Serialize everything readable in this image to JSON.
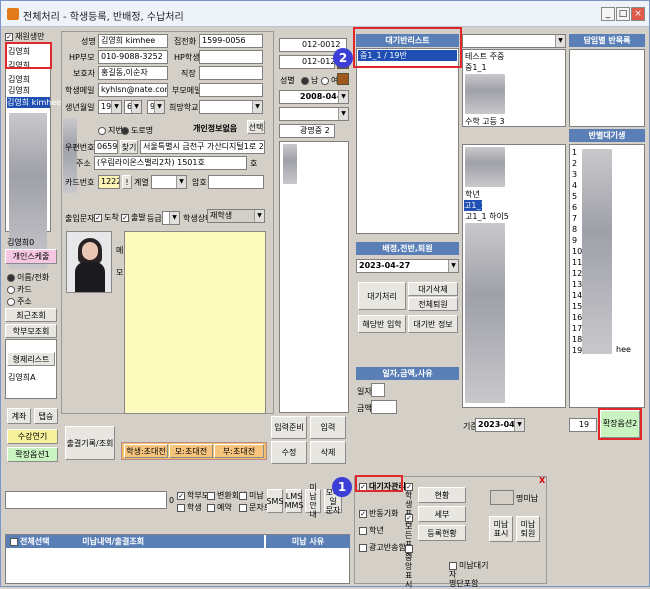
{
  "window": {
    "title": "전체처리 - 학생등록, 반배정, 수납처리"
  },
  "left": {
    "checkall": "재원생만",
    "names": [
      "김영희",
      "김영희",
      "김영희",
      "김영희",
      "김영희 kimhee"
    ],
    "bottom_name": "김영희0",
    "btn_personal": "개인스케줄",
    "radio_name": "이름/전화",
    "radio_card": "카드",
    "radio_addr": "주소",
    "btn_recent": "최근조회",
    "btn_parent": "학부모조회",
    "btn_sibling": "형제리스트",
    "sibling_name": "김영희A",
    "btn_account": "계좌",
    "btn_tab": "탭승",
    "btn_classes": "수강연기",
    "btn_expand1": "확장옵션1"
  },
  "form": {
    "name_label": "성명",
    "name": "김영희 kimhee",
    "home_label": "집전화",
    "home": "1599-0056",
    "hp_label": "HP부모",
    "hp": "010-9088-3252",
    "hp2_label": "HP학생",
    "hp2": "",
    "guardian_label": "보호자",
    "guardian": "홍길동,이순자",
    "job_label": "직장",
    "job": "",
    "email_label": "학생메일",
    "email": "kyhlsn@nate.com",
    "pmail_label": "부모메일",
    "pmail": "",
    "birth_label": "생년월일",
    "birth_y": "1987",
    "birth_m": "6",
    "birth_d": "9",
    "hope_label": "희망학교",
    "hope": "",
    "addr_type_old": "지번",
    "addr_type_new": "도로명",
    "noinfo": "개인정보없음",
    "select_btn": "선택",
    "zip_label": "우편번호",
    "zip": "06591",
    "find_btn": "찾기",
    "addr1": "서울특별시 금천구 가산디지털1로 2",
    "addr_label": "주소",
    "addr2": "(우림라이온스밸리2차) 1501호",
    "ho": "호",
    "card_label": "카드번호",
    "card": "1222",
    "excl": "!",
    "family_label": "계열",
    "pwd_label": "암호",
    "sms_label": "출입문자",
    "chk_arrive": "도착",
    "chk_leave": "출발",
    "grade_label": "등급",
    "status_label": "학생상태",
    "status": "재학생",
    "student_label": "식별",
    "student_id": "012-0012",
    "hakbun_label": "학번",
    "hakbun": "012-012",
    "gender_label": "성별",
    "gender_m": "남",
    "gender_f": "여",
    "consult_label": "상담",
    "consult": "2008-04-02",
    "motive_label": "동기",
    "school_label": "학교",
    "school": "광명중 2",
    "photo_side_1": "메",
    "photo_side_2": "모"
  },
  "middle_buttons": {
    "history": "출결기록/조회",
    "tags": [
      "학생:초대전",
      "모:초대전",
      "부:초대전"
    ],
    "prepare": "입력준비",
    "enter": "입력",
    "edit": "수정",
    "delete": "삭제"
  },
  "waitlist": {
    "header": "대기반리스트",
    "item": "중1_1 / 19반"
  },
  "assign": {
    "header": "배정,전반,퇴원",
    "date": "2023-04-27",
    "wait_proc": "대기처리",
    "wait_del": "대기삭제",
    "all_out": "전체퇴원",
    "join": "해당반 입학",
    "wait_info": "대기반 정보",
    "sub_header": "일자,금액,사유",
    "day_label": "일자",
    "amount_label": "금액"
  },
  "right": {
    "header_class": "담임별 반목록",
    "header_wait": "반별대기생",
    "list_top": [
      "테스트 주중",
      "중1_1"
    ],
    "list_top_last": "수학 고등 3",
    "list_mid": [
      "학년",
      "고1_1",
      "고1_1 하이5"
    ],
    "numbers": [
      "1",
      "2",
      "3",
      "4",
      "5",
      "6",
      "7",
      "8",
      "9",
      "10",
      "11",
      "12",
      "13",
      "14",
      "15",
      "16",
      "17",
      "18",
      "19"
    ],
    "kimhee": "hee",
    "base_label": "기준",
    "base_date": "2023-04-27",
    "count": "19",
    "expand2": "확장옵션2"
  },
  "footer": {
    "amount": "0",
    "chk_parent": "학부모",
    "chk_student": "학생",
    "chk_change": "변환회신",
    "chk_unpaid": "미납",
    "chk_reserve": "예약",
    "chk_msgonly": "문자로만",
    "sms": "SMS",
    "lms": "LMS\nMMS",
    "unpaid_inquiry": "미납\n안내",
    "form_inquiry": "모바일\n문자",
    "unpaid_header": "미납 사유",
    "list_header": "전체선택",
    "list_title": "미납내역/출결조회",
    "wait_mgmt": "대기자관리",
    "chk_sibling": "반동기화",
    "chk_grade": "학년",
    "chk_ad": "광고반송함",
    "right_chk1": "학생 표시",
    "right_chk2": "모든 표시",
    "right_chk3": "중앙 표시",
    "status_btn": "현황",
    "detail_btn": "세부",
    "register": "등록현황",
    "unpaid_count": "명미납",
    "unpaid_show": "미납\n표시",
    "unpaid_out": "미납\n퇴원",
    "chk_waitmember": "미납대기자\n명단포함",
    "close_x": "X"
  },
  "markers": {
    "m1": "1",
    "m2": "2"
  }
}
